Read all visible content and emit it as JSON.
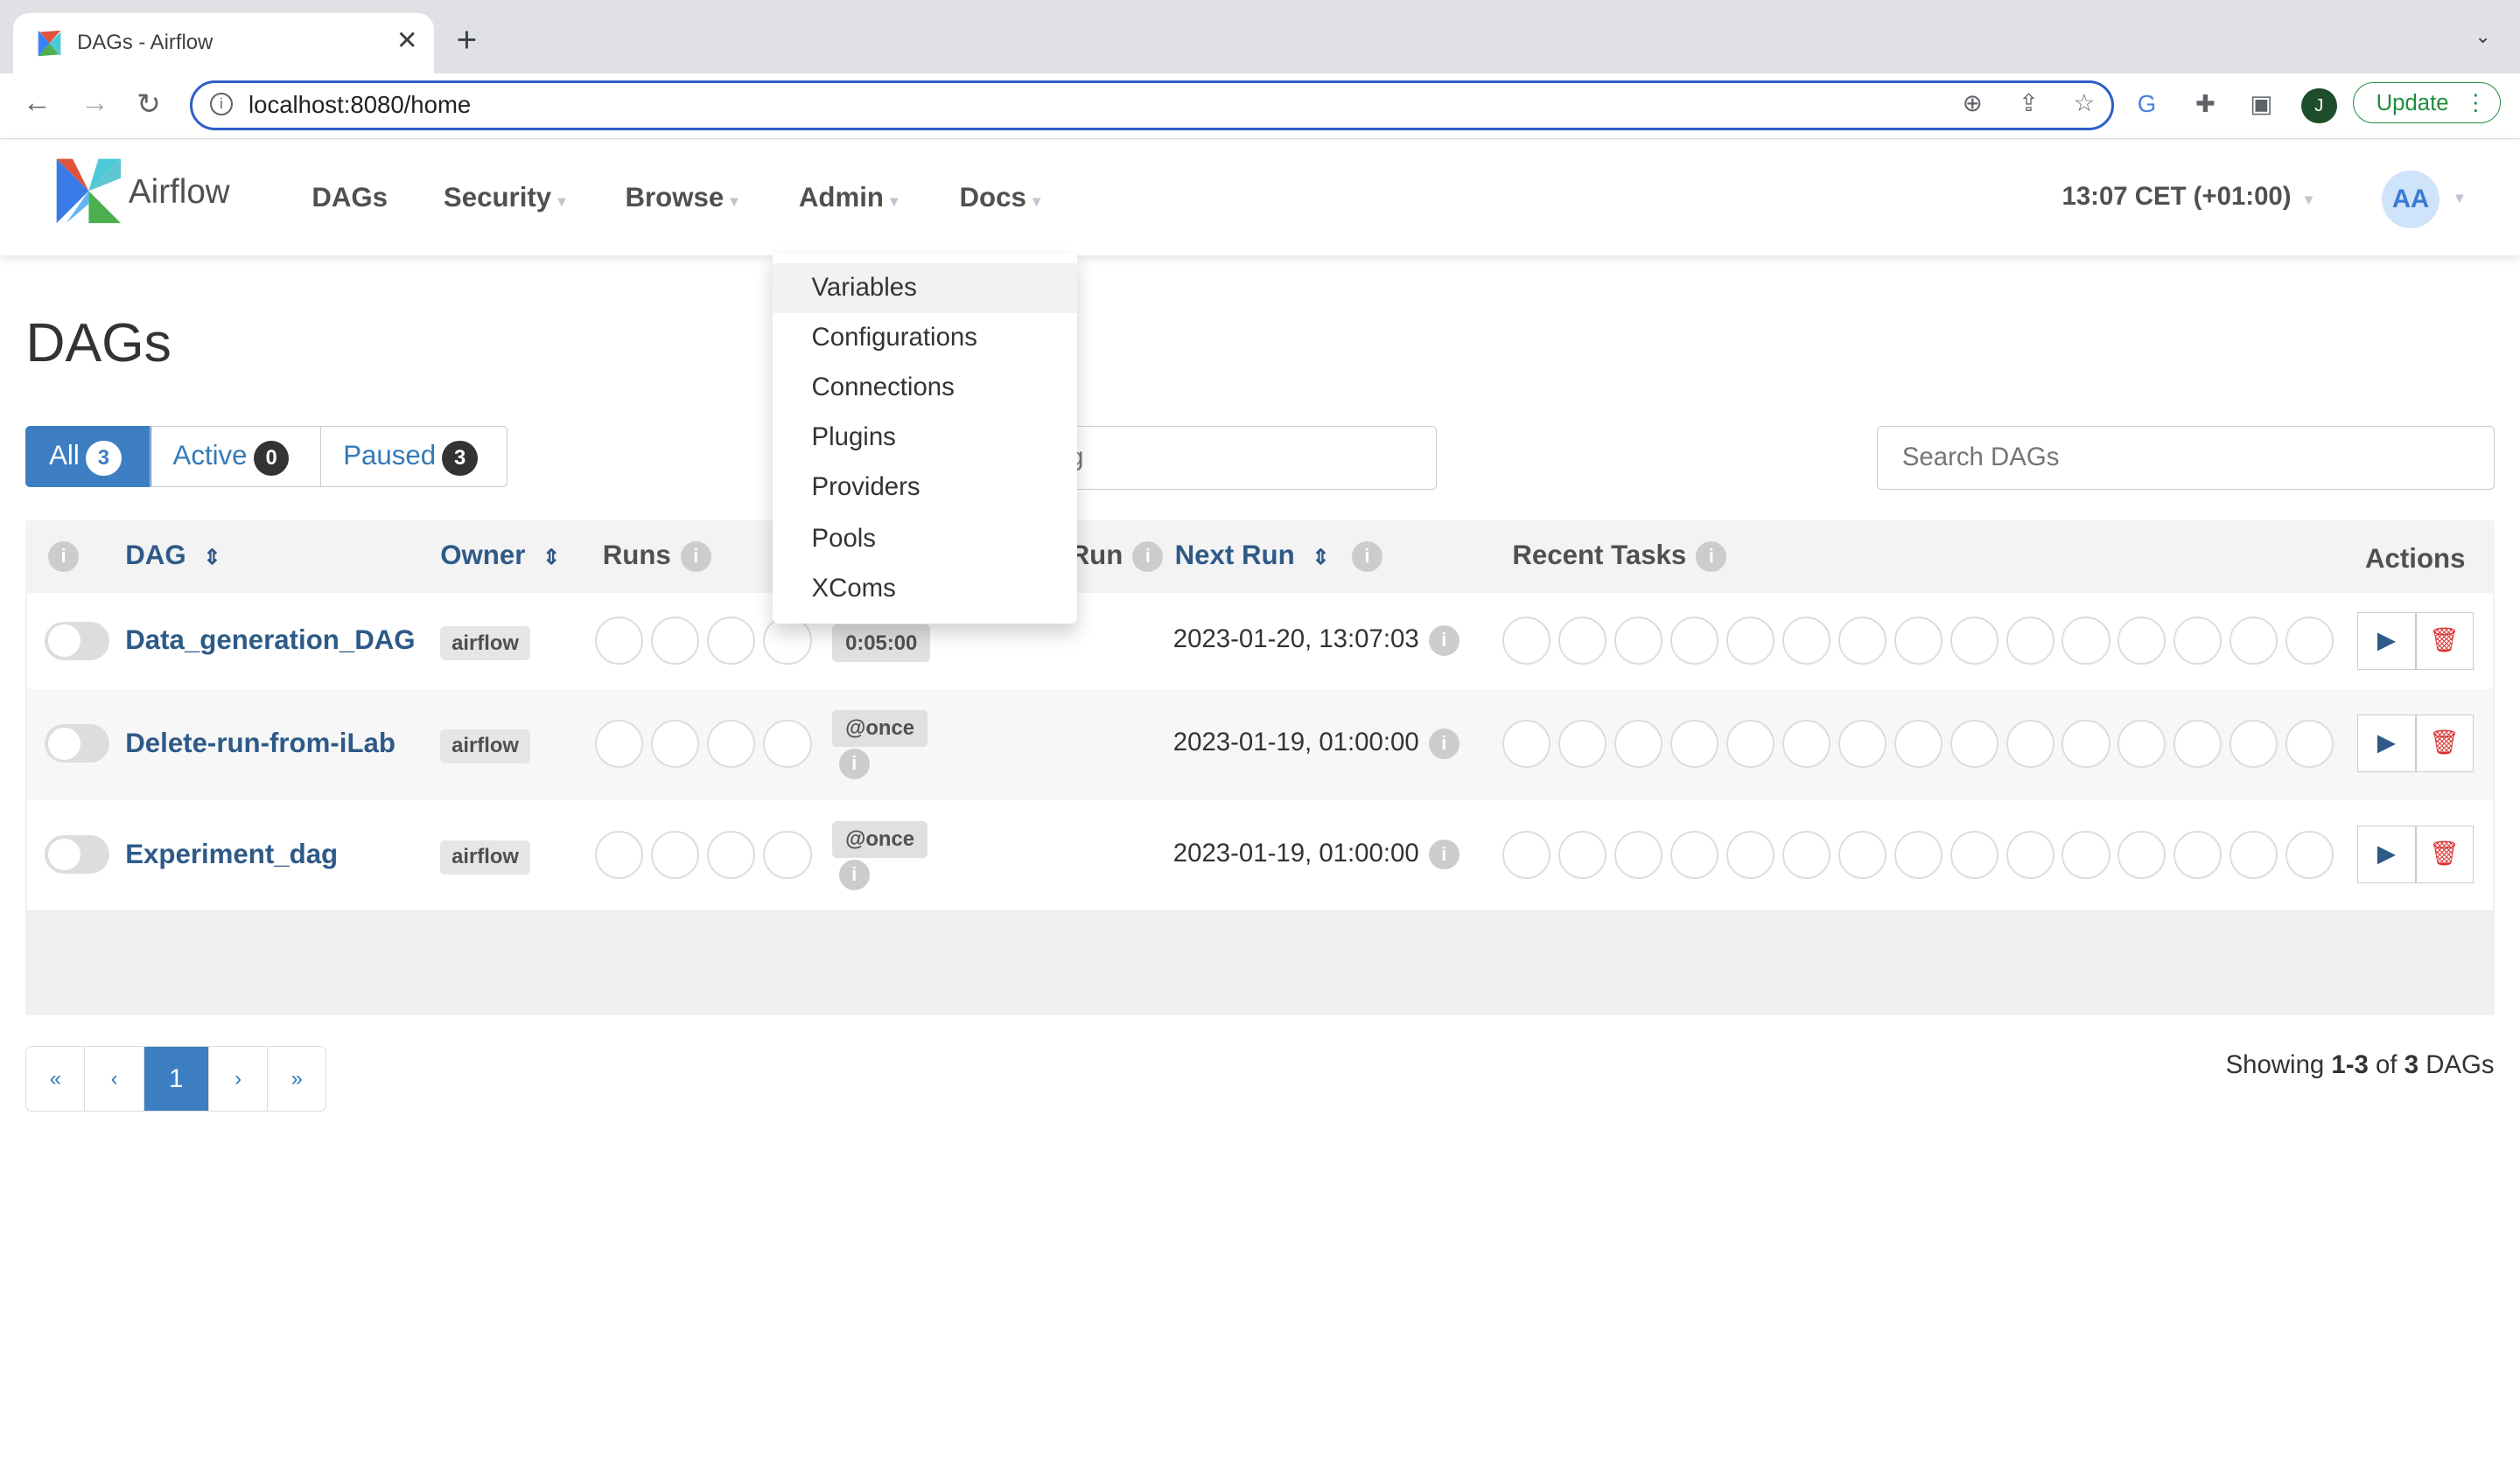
{
  "browser": {
    "tab_title": "DAGs - Airflow",
    "url": "localhost:8080/home",
    "update_label": "Update",
    "profile_initial": "J"
  },
  "navbar": {
    "brand": "Airflow",
    "items": [
      "DAGs",
      "Security",
      "Browse",
      "Admin",
      "Docs"
    ],
    "clock": "13:07 CET (+01:00)",
    "avatar": "AA"
  },
  "admin_menu": [
    "Variables",
    "Configurations",
    "Connections",
    "Plugins",
    "Providers",
    "Pools",
    "XComs"
  ],
  "page": {
    "title": "DAGs",
    "filters": [
      {
        "label": "All",
        "count": "3"
      },
      {
        "label": "Active",
        "count": "0"
      },
      {
        "label": "Paused",
        "count": "3"
      }
    ],
    "tag_placeholder": "Filter DAGs by tag",
    "search_placeholder": "Search DAGs"
  },
  "table": {
    "headers": {
      "dag": "DAG",
      "owner": "Owner",
      "runs": "Runs",
      "last_run": "Last Run",
      "next_run": "Next Run",
      "recent_tasks": "Recent Tasks",
      "actions": "Actions"
    },
    "rows": [
      {
        "dag": "Data_generation_DAG",
        "owner": "airflow",
        "schedule": "0:05:00",
        "next_run": "2023-01-20, 13:07:03"
      },
      {
        "dag": "Delete-run-from-iLab",
        "owner": "airflow",
        "schedule": "@once",
        "next_run": "2023-01-19, 01:00:00"
      },
      {
        "dag": "Experiment_dag",
        "owner": "airflow",
        "schedule": "@once",
        "next_run": "2023-01-19, 01:00:00"
      }
    ]
  },
  "pagination": {
    "first": "«",
    "prev": "‹",
    "current": "1",
    "next": "›",
    "last": "»",
    "showing_prefix": "Showing ",
    "range": "1-3",
    "of": " of ",
    "total": "3",
    "suffix": " DAGs"
  },
  "colors": {
    "accent": "#2e5a88",
    "active_filter": "#3d7ec2",
    "omnibox": "#2d5fc8"
  }
}
